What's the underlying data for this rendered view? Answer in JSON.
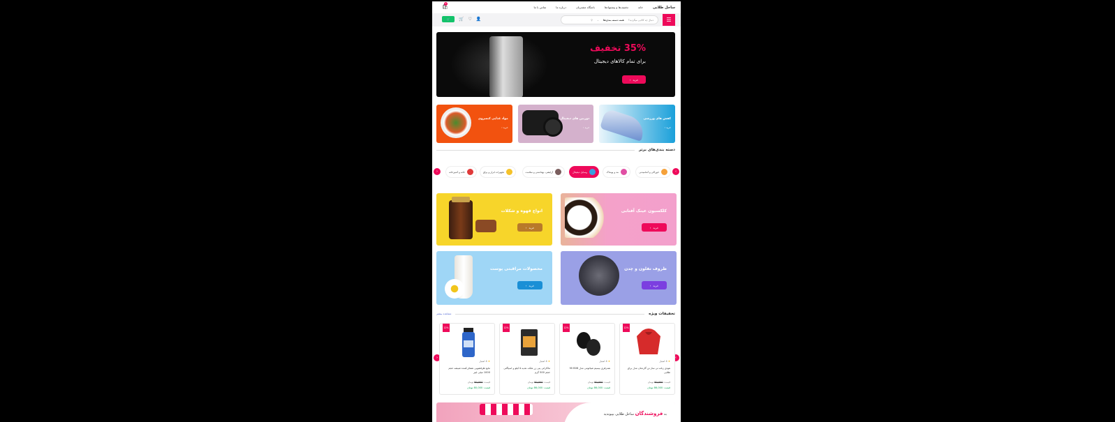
{
  "header": {
    "logo": "ساحل طلایی",
    "nav": [
      "خانه",
      "تخفیف‌ها و پیشنهادها",
      "باشگاه مشتریان",
      "درباره ما",
      "تماس با ما"
    ],
    "cart_count": "0"
  },
  "search": {
    "placeholder": "دنبال چه کالایی میگردید؟",
    "category": "همه دسته بندی‌ها"
  },
  "hero": {
    "title": "35% تخفیف",
    "subtitle": "برای تمام کالاهای دیجیتال",
    "button": "خرید"
  },
  "tiles": [
    {
      "title": "مواد غذایی کنسروی",
      "button": "خرید"
    },
    {
      "title": "دوربین های دیجیتال",
      "button": "خرید"
    },
    {
      "title": "کفش های ورزشی",
      "button": "خرید"
    }
  ],
  "categories_section": {
    "title": "دسته بندی‌های برتر",
    "items": [
      {
        "label": "خوراکی و آشامیدنی",
        "color": "#f5a13a"
      },
      {
        "label": "مد و پوشاک",
        "color": "#e04fa4"
      },
      {
        "label": "وسایل دیجیتال",
        "color": "#3aa0e0",
        "active": true
      },
      {
        "label": "آرایشی، بهداشتی و سلامت",
        "color": "#7a5e5e"
      },
      {
        "label": "تجهیزات ابزار و یراق",
        "color": "#f5c22a"
      },
      {
        "label": "خانه و آشپزخانه",
        "color": "#e03a3a"
      }
    ]
  },
  "promos": [
    {
      "title": "کلکسیون عینک آفتابی",
      "button": "خرید",
      "button_color": "#ee0a5a"
    },
    {
      "title": "انواع قهوه و شکلات",
      "button": "خرید",
      "button_color": "#b8792a"
    },
    {
      "title": "ظروف تفلون و چدن",
      "button": "خرید",
      "button_color": "#7b3fe0"
    },
    {
      "title": "محصولات مراقبتی پوست",
      "button": "خرید",
      "button_color": "#1a8fd6"
    }
  ],
  "specials": {
    "title": "تخفیفات ویژه",
    "more": "مشاهده بیشتر",
    "products": [
      {
        "badge": "12%",
        "rating": "4 امتیاز",
        "name": "هودی زنانه تی ساژ تن گاردمان مدل برای طلایی",
        "old_label": "قیمت:",
        "old_price": "80,000",
        "currency": "تومان",
        "new_label": "قیمت:",
        "new_price": "86,000",
        "new_currency": "تومان"
      },
      {
        "badge": "12%",
        "rating": "4 امتیاز",
        "name": "هندزفری بیسیم شیائومی مدل Mi B08",
        "old_label": "قیمت:",
        "old_price": "80,000",
        "currency": "تومان",
        "new_label": "قیمت:",
        "new_price": "86,000",
        "new_currency": "تومان"
      },
      {
        "badge": "12%",
        "rating": "4 امتیاز",
        "name": "ماکارانی پنی زر ملکه، هدیه ۵ کیلو و اسپاگتی‌ حجم 500 گرم",
        "old_label": "قیمت:",
        "old_price": "80,000",
        "currency": "تومان",
        "new_label": "قیمت:",
        "new_price": "86,000",
        "new_currency": "تومان"
      },
      {
        "badge": "12%",
        "rating": "4 امتیاز",
        "name": "مایع ظرفشویی شفاف‌کننده شیشه حجم 1000 میلی لیتر",
        "old_label": "قیمت:",
        "old_price": "80,000",
        "currency": "تومان",
        "new_label": "قیمت:",
        "new_price": "80,000",
        "new_currency": "تومان"
      }
    ]
  },
  "bottom_banner": {
    "prefix": "به",
    "highlight": "فروشندگان",
    "suffix": "ساحل طلایی بپیوندید"
  }
}
